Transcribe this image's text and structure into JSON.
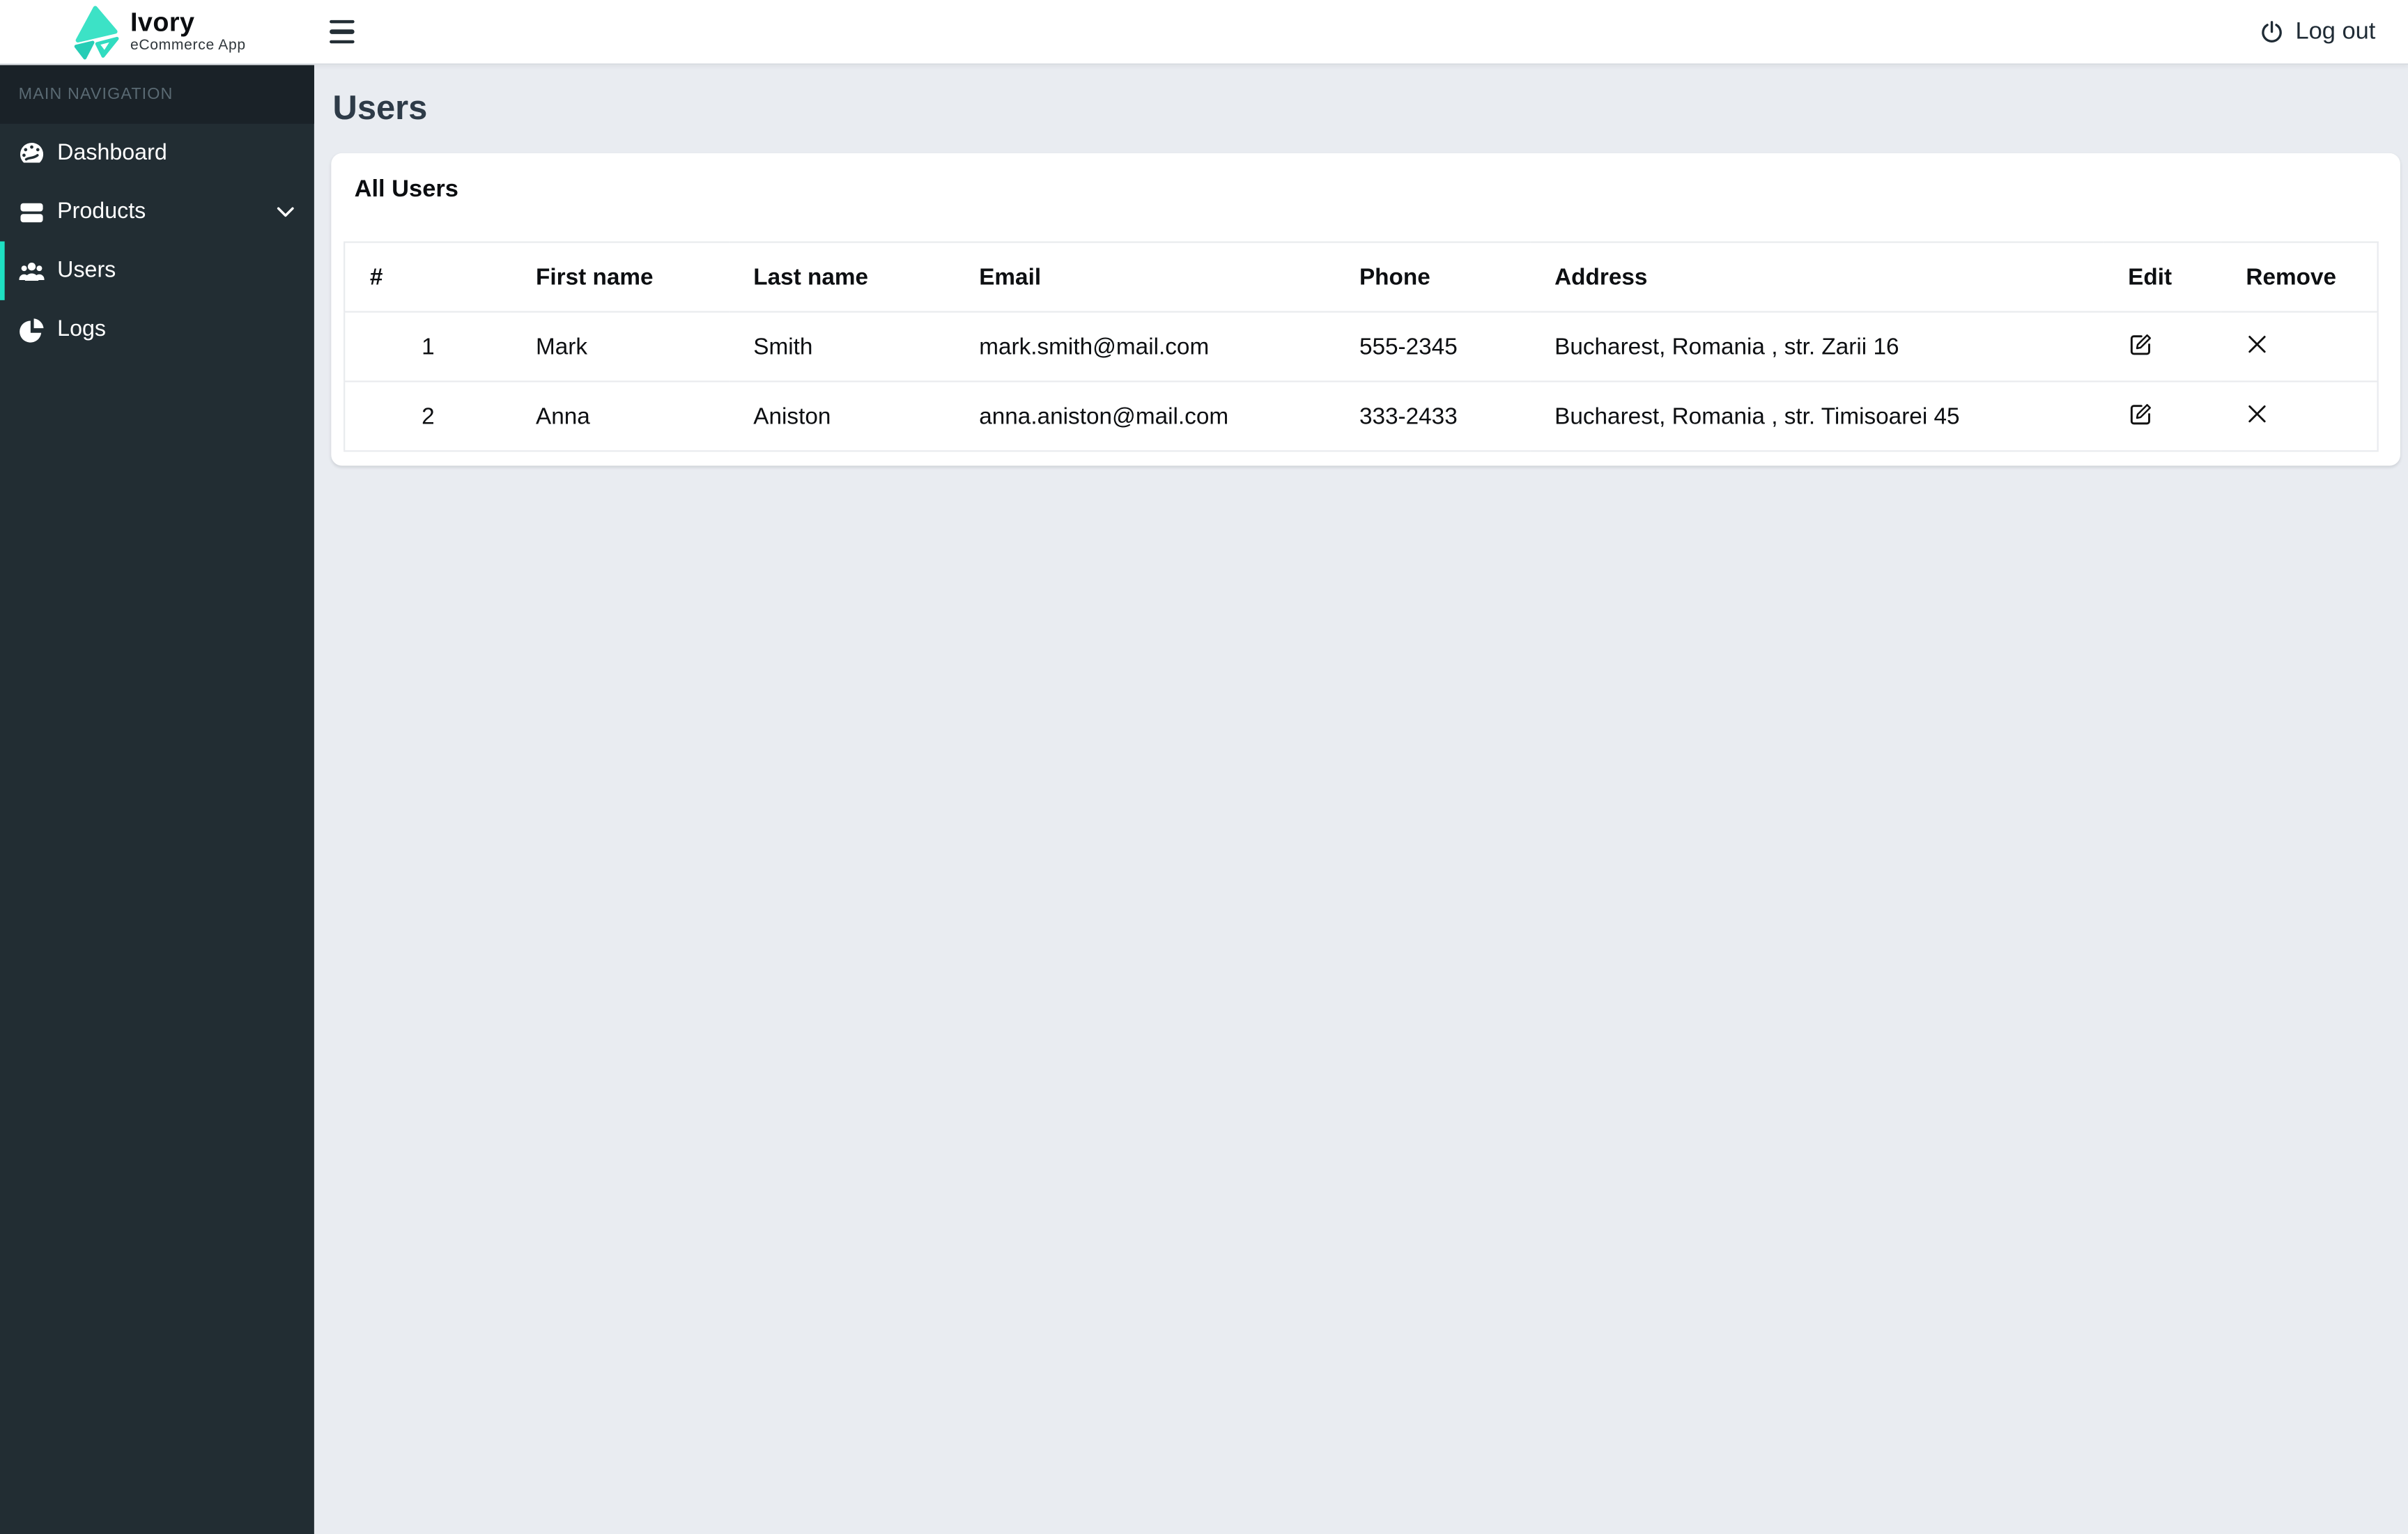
{
  "brand": {
    "name": "Ivory",
    "tagline": "eCommerce App"
  },
  "topbar": {
    "logout_label": "Log out"
  },
  "sidebar": {
    "section_label": "MAIN NAVIGATION",
    "items": [
      {
        "label": "Dashboard",
        "icon": "speedometer-icon",
        "active": false,
        "has_submenu": false
      },
      {
        "label": "Products",
        "icon": "products-stack-icon",
        "active": false,
        "has_submenu": true
      },
      {
        "label": "Users",
        "icon": "users-group-icon",
        "active": true,
        "has_submenu": false
      },
      {
        "label": "Logs",
        "icon": "pie-chart-icon",
        "active": false,
        "has_submenu": false
      }
    ]
  },
  "main": {
    "page_title": "Users",
    "card_title": "All Users",
    "table": {
      "columns": [
        "#",
        "First name",
        "Last name",
        "Email",
        "Phone",
        "Address",
        "Edit",
        "Remove"
      ],
      "rows": [
        {
          "num": "1",
          "first_name": "Mark",
          "last_name": "Smith",
          "email": "mark.smith@mail.com",
          "phone": "555-2345",
          "address": "Bucharest, Romania , str. Zarii 16"
        },
        {
          "num": "2",
          "first_name": "Anna",
          "last_name": "Aniston",
          "email": "anna.aniston@mail.com",
          "phone": "333-2433",
          "address": "Bucharest, Romania , str. Timisoarei 45"
        }
      ]
    }
  },
  "colors": {
    "accent": "#1ee0c2",
    "sidebar_bg": "#222d33",
    "sidebar_header_bg": "#1a2228",
    "content_bg": "#e9ecf1",
    "title_color": "#2e3b48",
    "logo_teal_light": "#3ce2c6",
    "logo_teal_dark": "#27cdb6"
  }
}
